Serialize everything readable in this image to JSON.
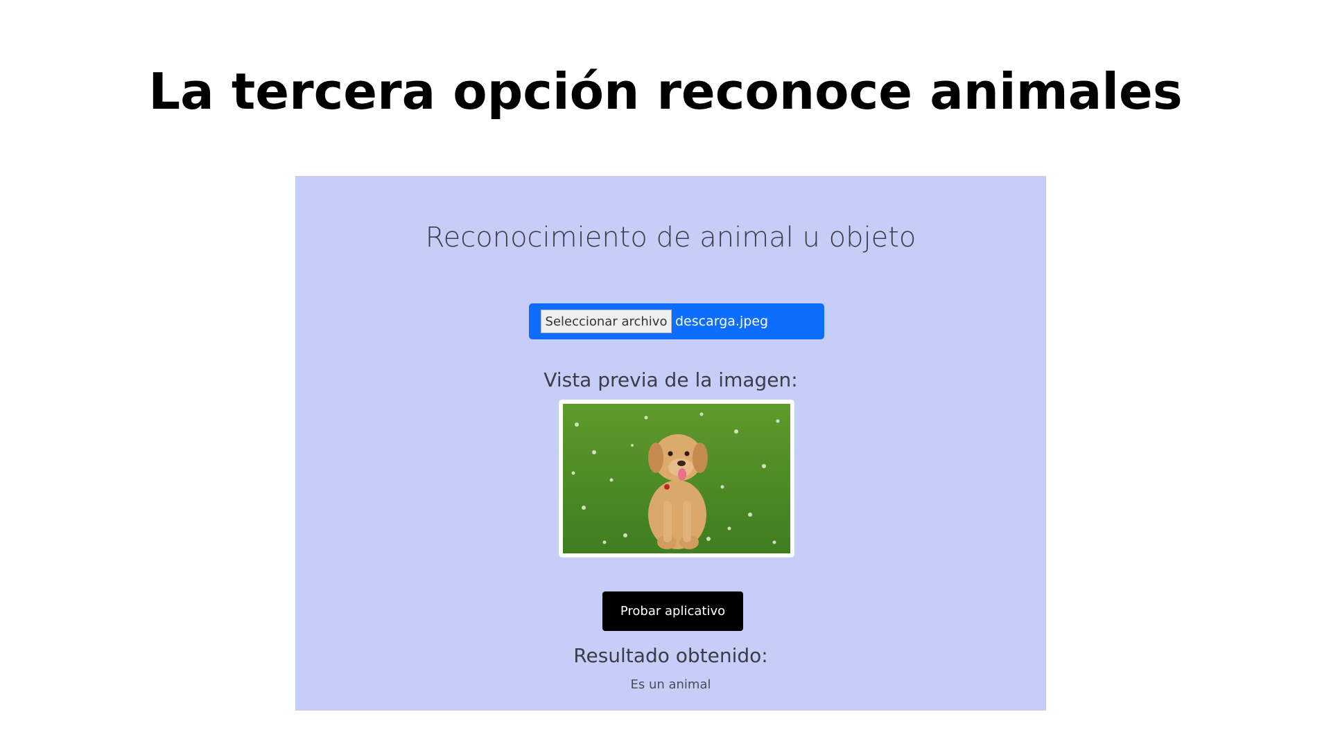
{
  "slide": {
    "title": "La tercera opción reconoce animales"
  },
  "app": {
    "heading": "Reconocimiento de animal u objeto",
    "file_input": {
      "button_label": "Seleccionar archivo",
      "file_name": "descarga.jpeg"
    },
    "preview_label": "Vista previa de la imagen:",
    "preview_image": {
      "icon": "dog-photo"
    },
    "test_button_label": "Probar aplicativo",
    "result_label": "Resultado obtenido:",
    "result_value": "Es un animal"
  },
  "colors": {
    "panel_background": "#c6cef7",
    "file_input_accent": "#0d6efd",
    "button_background": "#000000",
    "text_dark": "#3b3b4a"
  }
}
